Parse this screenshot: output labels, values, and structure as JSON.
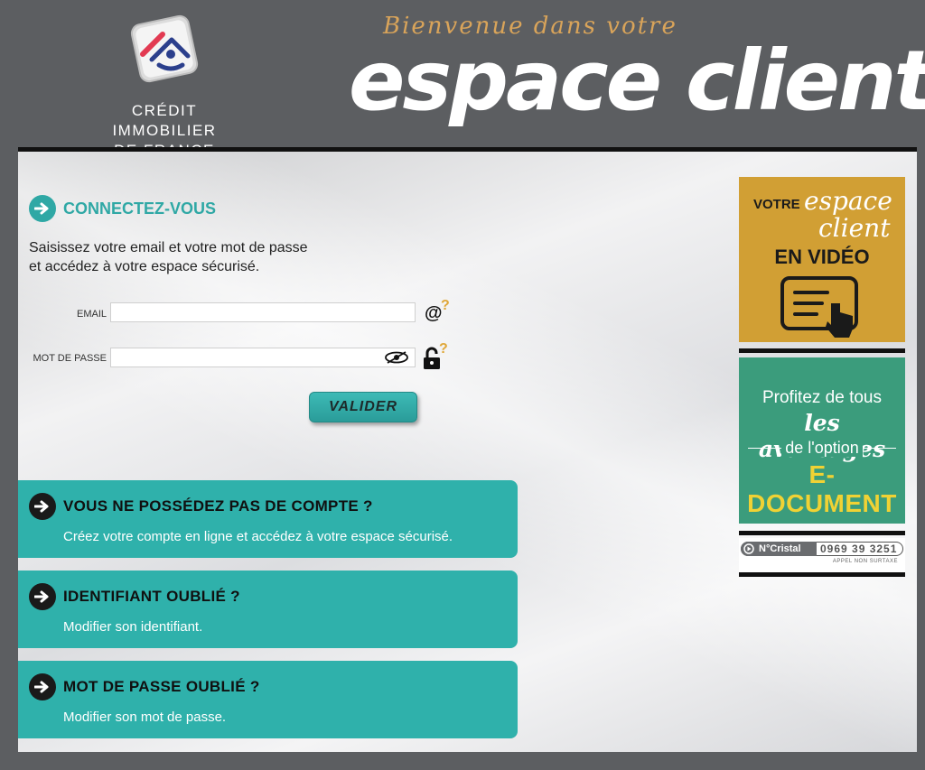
{
  "brand": {
    "logo_line1": "CRÉDIT IMMOBILIER",
    "logo_line2": "DE FRANCE",
    "welcome_small": "Bienvenue dans votre",
    "welcome_big": "espace client",
    "colors": {
      "teal": "#2fa8a5",
      "header": "#5c5e61",
      "gold": "#d19f34",
      "green": "#3b9c7c"
    }
  },
  "login": {
    "title": "CONNECTEZ-VOUS",
    "intro_line1": "Saisissez votre email et votre mot de passe",
    "intro_line2": "et accédez à votre espace sécurisé.",
    "email_label": "EMAIL",
    "email_value": "",
    "email_placeholder": "",
    "email_help_icon": "at-question-icon",
    "password_label": "MOT DE PASSE",
    "password_value": "",
    "password_placeholder": "",
    "password_help_icon": "lock-question-icon",
    "submit_label": "VALIDER"
  },
  "cards": [
    {
      "title": "VOUS NE POSSÉDEZ PAS DE COMPTE ?",
      "subtitle": "Créez votre compte en ligne et accédez à votre espace sécurisé."
    },
    {
      "title": "IDENTIFIANT OUBLIÉ ?",
      "subtitle": "Modifier son identifiant."
    },
    {
      "title": "MOT DE PASSE OUBLIÉ ?",
      "subtitle": "Modifier son mot de passe."
    }
  ],
  "sidebar": {
    "video_votre": "VOTRE",
    "video_espace": "espace",
    "video_client": "client",
    "video_en_video": "EN VIDÉO",
    "doc_line1": "Profitez de tous",
    "doc_line2": "les avantages",
    "doc_line3": "de l'option",
    "doc_line4": "E-DOCUMENT",
    "cristal_label": "N°Cristal",
    "cristal_number": "0969 39 3251",
    "cristal_note": "APPEL NON SURTAXE"
  }
}
